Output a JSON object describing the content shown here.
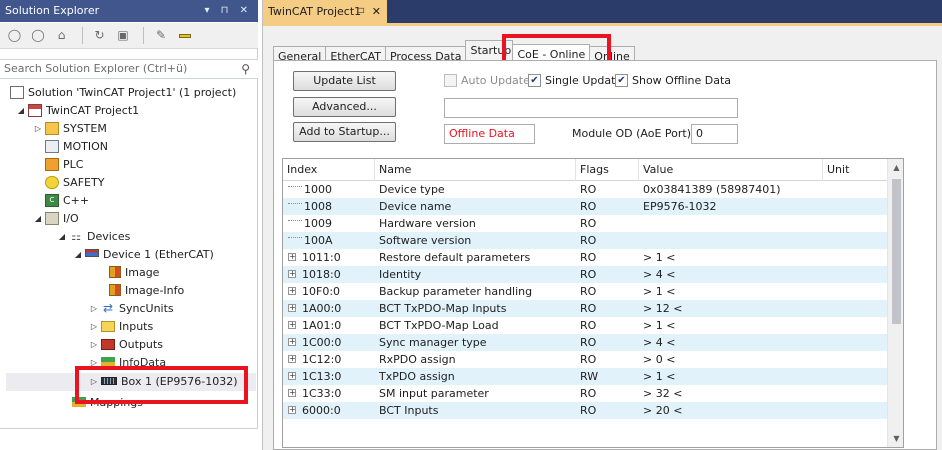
{
  "solution_explorer": {
    "title": "Solution Explorer",
    "title_controls": "▾ ⊓ ✕",
    "search_placeholder": "Search Solution Explorer (Ctrl+ü)",
    "tree": [
      {
        "label": "Solution 'TwinCAT Project1' (1 project)",
        "icon": "solution-icon"
      },
      {
        "label": "TwinCAT Project1",
        "icon": "twincat-project-icon"
      },
      {
        "label": "SYSTEM",
        "icon": "system-icon"
      },
      {
        "label": "MOTION",
        "icon": "motion-icon"
      },
      {
        "label": "PLC",
        "icon": "plc-icon"
      },
      {
        "label": "SAFETY",
        "icon": "safety-icon"
      },
      {
        "label": "C++",
        "icon": "cpp-icon"
      },
      {
        "label": "I/O",
        "icon": "io-icon"
      },
      {
        "label": "Devices",
        "icon": "devices-icon"
      },
      {
        "label": "Device 1 (EtherCAT)",
        "icon": "ethercat-device-icon"
      },
      {
        "label": "Image",
        "icon": "image-icon"
      },
      {
        "label": "Image-Info",
        "icon": "image-info-icon"
      },
      {
        "label": "SyncUnits",
        "icon": "syncunits-icon"
      },
      {
        "label": "Inputs",
        "icon": "inputs-folder-icon"
      },
      {
        "label": "Outputs",
        "icon": "outputs-folder-icon"
      },
      {
        "label": "InfoData",
        "icon": "infodata-icon"
      },
      {
        "label": "Box 1 (EP9576-1032)",
        "icon": "box-icon"
      },
      {
        "label": "Mappings",
        "icon": "mappings-icon"
      }
    ]
  },
  "document": {
    "tab_title": "TwinCAT Project1",
    "tabs": [
      "General",
      "EtherCAT",
      "Process Data",
      "Startup",
      "CoE - Online",
      "Online"
    ],
    "active_tab": "CoE - Online",
    "buttons": {
      "update_list": "Update List",
      "advanced": "Advanced...",
      "add_to_startup": "Add to Startup..."
    },
    "checks": {
      "auto_update": "Auto Update",
      "single_update": "Single Update",
      "show_offline": "Show Offline Data"
    },
    "offline_data": "Offline Data",
    "module_od_label": "Module OD (AoE Port):",
    "module_od_value": "0",
    "grid": {
      "headers": [
        "Index",
        "Name",
        "Flags",
        "Value",
        "Unit"
      ],
      "rows": [
        {
          "expand": false,
          "index": "1000",
          "name": "Device type",
          "flags": "RO",
          "value": "0x03841389 (58987401)"
        },
        {
          "expand": false,
          "index": "1008",
          "name": "Device name",
          "flags": "RO",
          "value": "EP9576-1032"
        },
        {
          "expand": false,
          "index": "1009",
          "name": "Hardware version",
          "flags": "RO",
          "value": ""
        },
        {
          "expand": false,
          "index": "100A",
          "name": "Software version",
          "flags": "RO",
          "value": ""
        },
        {
          "expand": true,
          "index": "1011:0",
          "name": "Restore default parameters",
          "flags": "RO",
          "value": "> 1 <"
        },
        {
          "expand": true,
          "index": "1018:0",
          "name": "Identity",
          "flags": "RO",
          "value": "> 4 <"
        },
        {
          "expand": true,
          "index": "10F0:0",
          "name": "Backup parameter handling",
          "flags": "RO",
          "value": "> 1 <"
        },
        {
          "expand": true,
          "index": "1A00:0",
          "name": "BCT TxPDO-Map Inputs",
          "flags": "RO",
          "value": "> 12 <"
        },
        {
          "expand": true,
          "index": "1A01:0",
          "name": "BCT TxPDO-Map Load",
          "flags": "RO",
          "value": "> 1 <"
        },
        {
          "expand": true,
          "index": "1C00:0",
          "name": "Sync manager type",
          "flags": "RO",
          "value": "> 4 <"
        },
        {
          "expand": true,
          "index": "1C12:0",
          "name": "RxPDO assign",
          "flags": "RO",
          "value": "> 0 <"
        },
        {
          "expand": true,
          "index": "1C13:0",
          "name": "TxPDO assign",
          "flags": "RW",
          "value": "> 1 <"
        },
        {
          "expand": true,
          "index": "1C33:0",
          "name": "SM input parameter",
          "flags": "RO",
          "value": "> 32 <"
        },
        {
          "expand": true,
          "index": "6000:0",
          "name": "BCT Inputs",
          "flags": "RO",
          "value": "> 20 <"
        }
      ]
    }
  },
  "colors": {
    "highlight": "#e8141f",
    "title_bar": "#40568d",
    "doc_tab": "#f5cc84",
    "row_alt": "#e1f2fb"
  }
}
